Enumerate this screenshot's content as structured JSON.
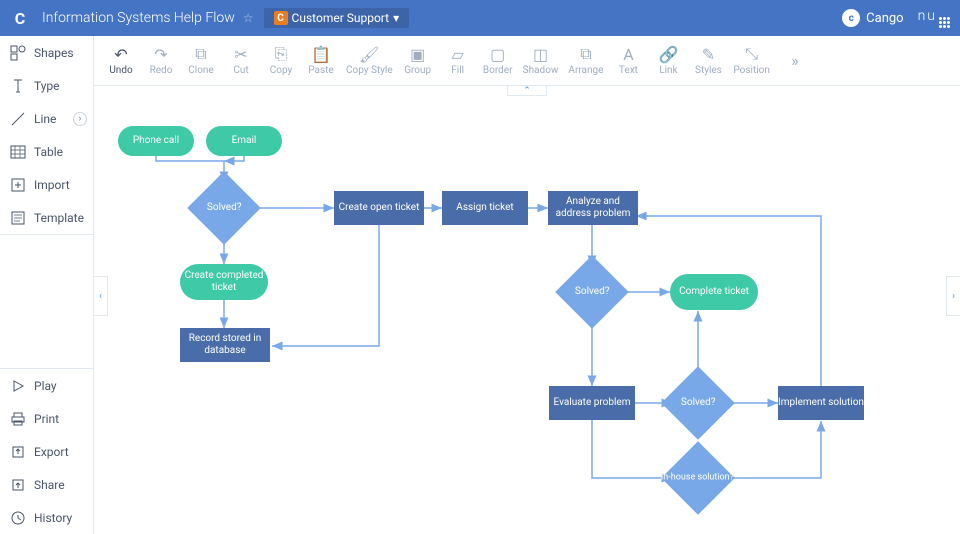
{
  "header": {
    "title": "Information Systems Help Flow",
    "tag": "Customer Support",
    "user": "Cango",
    "brand": "nu"
  },
  "sidebar": {
    "top": [
      {
        "label": "Shapes"
      },
      {
        "label": "Type"
      },
      {
        "label": "Line"
      },
      {
        "label": "Table"
      },
      {
        "label": "Import"
      },
      {
        "label": "Template"
      }
    ],
    "bottom": [
      {
        "label": "Play"
      },
      {
        "label": "Print"
      },
      {
        "label": "Export"
      },
      {
        "label": "Share"
      },
      {
        "label": "History"
      }
    ]
  },
  "toolbar": [
    {
      "label": "Undo",
      "active": true
    },
    {
      "label": "Redo"
    },
    {
      "label": "Clone"
    },
    {
      "label": "Cut"
    },
    {
      "label": "Copy"
    },
    {
      "label": "Paste"
    },
    {
      "label": "Copy Style"
    },
    {
      "label": "Group"
    },
    {
      "label": "Fill"
    },
    {
      "label": "Border"
    },
    {
      "label": "Shadow"
    },
    {
      "label": "Arrange"
    },
    {
      "label": "Text"
    },
    {
      "label": "Link"
    },
    {
      "label": "Styles"
    },
    {
      "label": "Position"
    }
  ],
  "nodes": {
    "phone_call": "Phone call",
    "email": "Email",
    "solved1": "Solved?",
    "create_open": "Create open ticket",
    "assign": "Assign ticket",
    "analyze": "Analyze and address problem",
    "create_completed": "Create completed ticket",
    "record": "Record stored in database",
    "solved2": "Solved?",
    "complete": "Complete ticket",
    "evaluate": "Evaluate problem",
    "solved3": "Solved?",
    "implement": "Implement solution",
    "inhouse": "In-house solution?"
  }
}
